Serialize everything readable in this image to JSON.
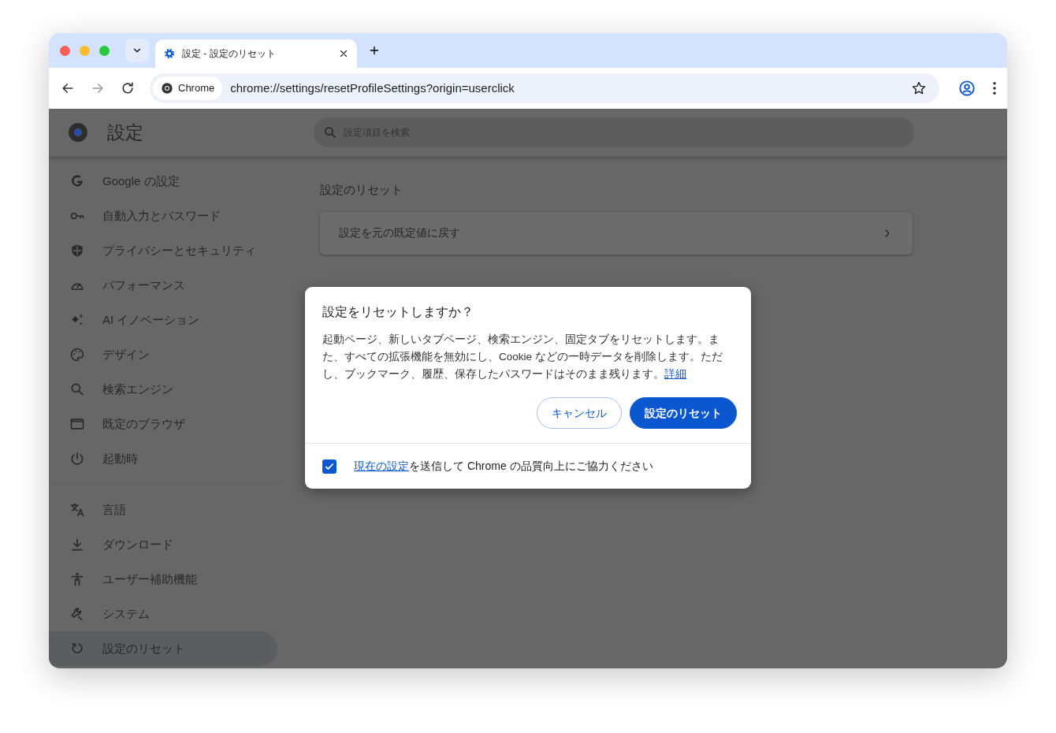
{
  "tabs": [
    {
      "label": "設定 - 設定のリセット",
      "selected": true
    }
  ],
  "address": {
    "chip": "Chrome",
    "url": "chrome://settings/resetProfileSettings?origin=userclick"
  },
  "settings": {
    "title": "設定",
    "search": {
      "placeholder": "設定項目を検索"
    }
  },
  "sidebar": {
    "groups": [
      {
        "items": [
          {
            "label": "Google の設定",
            "selected": false
          },
          {
            "label": "自動入力とパスワード",
            "selected": false
          },
          {
            "label": "プライバシーとセキュリティ",
            "selected": false
          },
          {
            "label": "パフォーマンス",
            "selected": false
          },
          {
            "label": "AI イノベーション",
            "selected": false
          },
          {
            "label": "デザイン",
            "selected": false
          },
          {
            "label": "検索エンジン",
            "selected": false
          },
          {
            "label": "既定のブラウザ",
            "selected": false
          },
          {
            "label": "起動時",
            "selected": false
          }
        ]
      },
      {
        "items": [
          {
            "label": "言語",
            "selected": false
          },
          {
            "label": "ダウンロード",
            "selected": false
          },
          {
            "label": "ユーザー補助機能",
            "selected": false
          },
          {
            "label": "システム",
            "selected": false
          },
          {
            "label": "設定のリセット",
            "selected": true
          }
        ]
      }
    ]
  },
  "main": {
    "heading": "設定のリセット",
    "card": {
      "label": "設定を元の既定値に戻す"
    }
  },
  "dialog": {
    "title": "設定をリセットしますか？",
    "body": {
      "text": "起動ページ、新しいタブページ、検索エンジン、固定タブをリセットします。また、すべての拡張機能を無効にし、Cookie などの一時データを削除します。ただし、ブックマーク、履歴、保存したパスワードはそのまま残ります。",
      "link": "詳細"
    },
    "buttons": [
      {
        "label": "キャンセル",
        "kind": "secondary"
      },
      {
        "label": "設定のリセット",
        "kind": "primary"
      }
    ],
    "consent": {
      "checked": true,
      "link": "現在の設定",
      "text": "を送信して Chrome の品質向上にご協力ください"
    }
  }
}
